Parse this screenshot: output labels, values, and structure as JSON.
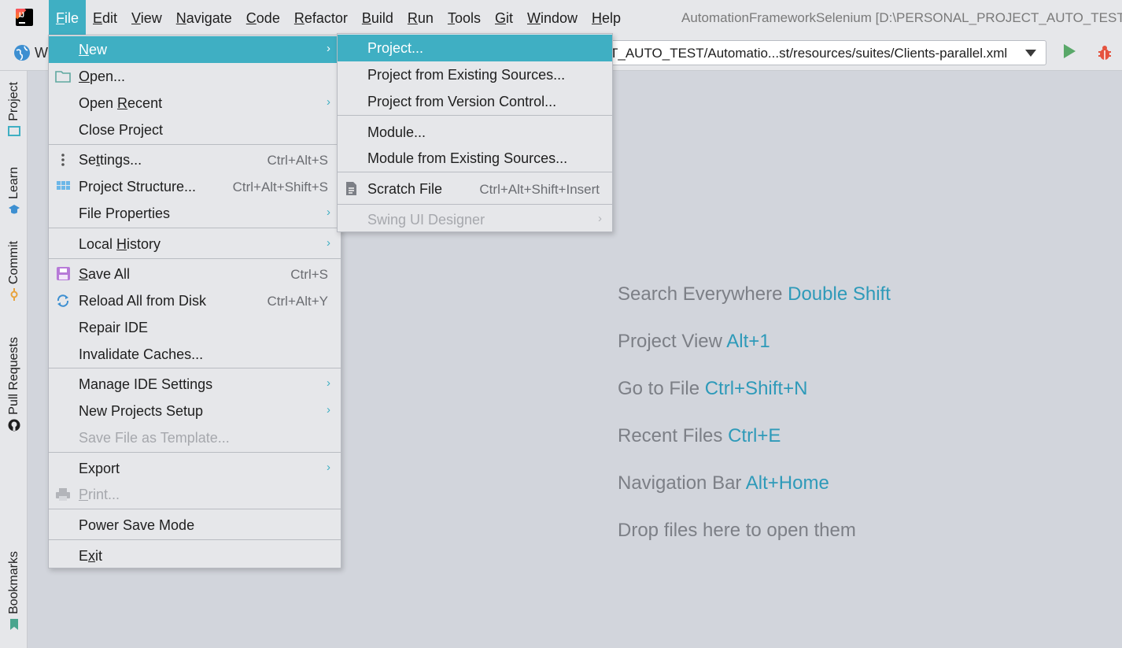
{
  "menubar": {
    "items": [
      {
        "label": "File",
        "key": "F",
        "rest": "ile"
      },
      {
        "label": "Edit",
        "key": "E",
        "rest": "dit"
      },
      {
        "label": "View",
        "key": "V",
        "rest": "iew"
      },
      {
        "label": "Navigate",
        "key": "N",
        "rest": "avigate"
      },
      {
        "label": "Code",
        "key": "C",
        "rest": "ode"
      },
      {
        "label": "Refactor",
        "key": "R",
        "rest": "efactor"
      },
      {
        "label": "Build",
        "key": "B",
        "rest": "uild"
      },
      {
        "label": "Run",
        "key": "R",
        "rest": "un"
      },
      {
        "label": "Tools",
        "key": "T",
        "rest": "ools"
      },
      {
        "label": "Git",
        "key": "G",
        "rest": "it"
      },
      {
        "label": "Window",
        "key": "W",
        "rest": "indow"
      },
      {
        "label": "Help",
        "key": "H",
        "rest": "elp"
      }
    ],
    "window_title": "AutomationFrameworkSelenium [D:\\PERSONAL_PROJECT_AUTO_TEST\\"
  },
  "toolbar": {
    "project_initial": "W",
    "run_config": "T_AUTO_TEST/Automatio...st/resources/suites/Clients-parallel.xml"
  },
  "left_strip": {
    "tabs": [
      "Project",
      "Learn",
      "Commit",
      "Pull Requests",
      "Bookmarks"
    ]
  },
  "hints": [
    {
      "text": "Search Everywhere",
      "key": "Double Shift"
    },
    {
      "text": "Project View",
      "key": "Alt+1"
    },
    {
      "text": "Go to File",
      "key": "Ctrl+Shift+N"
    },
    {
      "text": "Recent Files",
      "key": "Ctrl+E"
    },
    {
      "text": "Navigation Bar",
      "key": "Alt+Home"
    },
    {
      "text": "Drop files here to open them",
      "key": ""
    }
  ],
  "file_menu": {
    "new": "New",
    "open": "Open...",
    "open_recent": "Open Recent",
    "close_project": "Close Project",
    "settings": "Settings...",
    "settings_sc": "Ctrl+Alt+S",
    "project_structure": "Project Structure...",
    "project_structure_sc": "Ctrl+Alt+Shift+S",
    "file_properties": "File Properties",
    "local_history": "Local History",
    "save_all": "Save All",
    "save_all_sc": "Ctrl+S",
    "reload_all": "Reload All from Disk",
    "reload_all_sc": "Ctrl+Alt+Y",
    "repair_ide": "Repair IDE",
    "invalidate_caches": "Invalidate Caches...",
    "manage_ide_settings": "Manage IDE Settings",
    "new_projects_setup": "New Projects Setup",
    "save_file_as_template": "Save File as Template...",
    "export": "Export",
    "print": "Print...",
    "power_save_mode": "Power Save Mode",
    "exit": "Exit"
  },
  "new_menu": {
    "project": "Project...",
    "project_existing": "Project from Existing Sources...",
    "project_vcs": "Project from Version Control...",
    "module": "Module...",
    "module_existing": "Module from Existing Sources...",
    "scratch_file": "Scratch File",
    "scratch_file_sc": "Ctrl+Alt+Shift+Insert",
    "swing_ui_designer": "Swing UI Designer"
  },
  "colors": {
    "accent": "#3fafc3",
    "hint_key": "#2e9ab9",
    "run": "#59a869",
    "debug": "#e5533f"
  }
}
